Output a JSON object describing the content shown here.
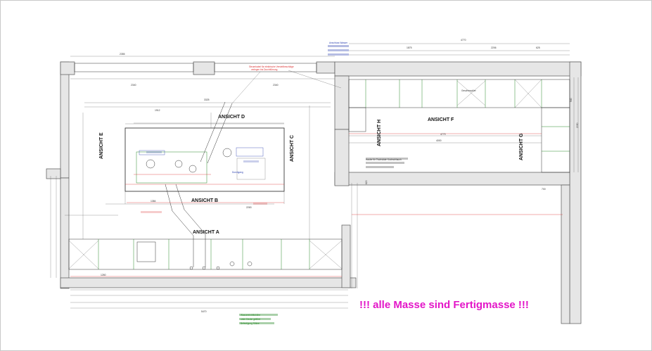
{
  "views": {
    "a": "ANSICHT A",
    "b": "ANSICHT B",
    "c": "ANSICHT C",
    "d": "ANSICHT D",
    "e": "ANSICHT E",
    "f": "ANSICHT F",
    "g": "ANSICHT G",
    "h": "ANSICHT H"
  },
  "notes": {
    "red_top": "Steuerkabel für elektrische Verstellbeschläge",
    "red_top2": "verlegen bis Durchführung",
    "blue_top": "Anschluss Wasser",
    "hood_text": "Haube für Tischsäule Kochschlauch",
    "dishwasher": "Geschirrspüler",
    "measure_note": "Durchgang",
    "green_bottom1": "Wassereintrittshöhe",
    "green_bottom2": "unter Decke geführt",
    "green_bottom3": "Befestigung Stütze"
  },
  "dimensions": {
    "top_total": "4770",
    "top_1": "1875",
    "top_2": "2206",
    "top_3": "625",
    "left_top": "2355",
    "d_total": "3325",
    "d_1": "1912",
    "left_wall": "2340",
    "right_wall": "2340",
    "inner_4779": "4779",
    "inner_4000": "4000",
    "bottom_total": "5470",
    "bottom_1260": "1260",
    "b_2263": "2263",
    "b_1384": "1384",
    "v_620": "620",
    "r_700": "700",
    "r_940": "940",
    "r_2050": "2050"
  },
  "footer": {
    "note": "!!! alle Masse sind Fertigmasse !!!"
  },
  "colors": {
    "note_magenta": "#e316c8",
    "dim_red": "#d33333",
    "dim_blue": "#2a3fb0",
    "outline_green": "#2b8a2b"
  }
}
